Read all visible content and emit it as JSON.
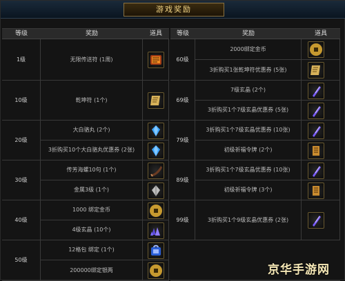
{
  "title": "游戏奖励",
  "headers": {
    "left": {
      "level": "等级",
      "reward": "奖励",
      "item": "道具"
    },
    "right": {
      "level": "等级",
      "reward": "奖励",
      "item": "道具"
    }
  },
  "left_table": [
    {
      "level": "1级",
      "rewards": [
        "无限传送符 (1周)"
      ],
      "icons": [
        "teleport-scroll-icon"
      ]
    },
    {
      "level": "10级",
      "rewards": [
        "乾坤符 (1个)"
      ],
      "icons": [
        "qiankun-talisman-icon"
      ]
    },
    {
      "level": "20级",
      "rewards": [
        "大白骆丸 (2个)",
        "3折购买10个大白骆丸优惠券 (2张)"
      ],
      "icons": [
        "blue-gem-icon",
        "blue-gem-icon"
      ]
    },
    {
      "level": "30级",
      "rewards": [
        "传芳海螺10句 (1个)",
        "金属3级 (1个)"
      ],
      "icons": [
        "horn-icon",
        "crystal-icon"
      ]
    },
    {
      "level": "40级",
      "rewards": [
        "1000 绑定金币",
        "4级玄晶 (10个)"
      ],
      "icons": [
        "coin-icon",
        "purple-crystal-icon"
      ]
    },
    {
      "level": "50级",
      "rewards": [
        "12格包 绑定 (1个)",
        "200000绑定银两"
      ],
      "icons": [
        "bag-icon",
        "coin-icon"
      ]
    }
  ],
  "right_table": [
    {
      "level": "60级",
      "rewards": [
        "2000绑定金币",
        "3折购买1张乾坤符优惠券 (5张)"
      ],
      "icons": [
        "coin-icon",
        "qiankun-talisman-icon"
      ]
    },
    {
      "level": "69级",
      "rewards": [
        "7级玄晶 (2个)",
        "3折购买1个7级玄晶优惠券 (5张)"
      ],
      "icons": [
        "purple-gem-icon",
        "purple-gem-icon"
      ]
    },
    {
      "level": "79级",
      "rewards": [
        "3折购买1个7级玄晶优惠券 (10张)",
        "初级祈福令牌 (2个)"
      ],
      "icons": [
        "purple-gem-icon",
        "token-icon"
      ]
    },
    {
      "level": "89级",
      "rewards": [
        "3折购买1个7级玄晶优惠券 (10张)",
        "初级祈福令牌 (3个)"
      ],
      "icons": [
        "purple-gem-icon",
        "token-icon"
      ]
    },
    {
      "level": "99级",
      "rewards": [
        "3折购买1个9级玄晶优惠券 (2张)"
      ],
      "icons": [
        "purple-gem-icon"
      ]
    }
  ],
  "watermark": "京华手游网",
  "colors": {
    "background": "#141414",
    "header": "#2a2a2a",
    "title": "#f3d585",
    "grid": "#3a3a3a"
  }
}
